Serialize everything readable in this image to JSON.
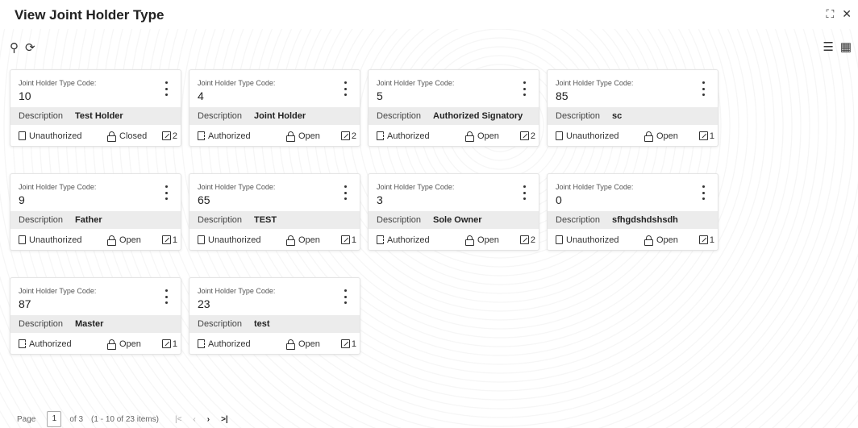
{
  "header": {
    "title": "View Joint Holder Type"
  },
  "window_icons": {
    "expand_icon": "⛶",
    "close_icon": "✕"
  },
  "toolbar": {
    "search_icon": "⚲",
    "refresh_icon": "⟳"
  },
  "view_icons": {
    "list_icon": "☰",
    "grid_icon": "▦"
  },
  "labels": {
    "code_label": "Joint Holder Type Code:",
    "description_label": "Description"
  },
  "cards": [
    {
      "code": "10",
      "description": "Test Holder",
      "auth": "Unauthorized",
      "status": "Closed",
      "mod": "2"
    },
    {
      "code": "4",
      "description": "Joint Holder",
      "auth": "Authorized",
      "status": "Open",
      "mod": "2"
    },
    {
      "code": "5",
      "description": "Authorized Signatory",
      "auth": "Authorized",
      "status": "Open",
      "mod": "2"
    },
    {
      "code": "85",
      "description": "sc",
      "auth": "Unauthorized",
      "status": "Open",
      "mod": "1"
    },
    {
      "code": "9",
      "description": "Father",
      "auth": "Unauthorized",
      "status": "Open",
      "mod": "1"
    },
    {
      "code": "65",
      "description": "TEST",
      "auth": "Unauthorized",
      "status": "Open",
      "mod": "1"
    },
    {
      "code": "3",
      "description": "Sole Owner",
      "auth": "Authorized",
      "status": "Open",
      "mod": "2"
    },
    {
      "code": "0",
      "description": "sfhgdshdshsdh",
      "auth": "Unauthorized",
      "status": "Open",
      "mod": "1"
    },
    {
      "code": "87",
      "description": "Master",
      "auth": "Authorized",
      "status": "Open",
      "mod": "1"
    },
    {
      "code": "23",
      "description": "test",
      "auth": "Authorized",
      "status": "Open",
      "mod": "1"
    }
  ],
  "pager": {
    "page_label": "Page",
    "current_page": "1",
    "of_label": "of 3",
    "items_label": "(1 - 10 of 23 items)",
    "first_icon": "|<",
    "prev_icon": "‹",
    "next_icon": "›",
    "last_icon": ">|"
  }
}
